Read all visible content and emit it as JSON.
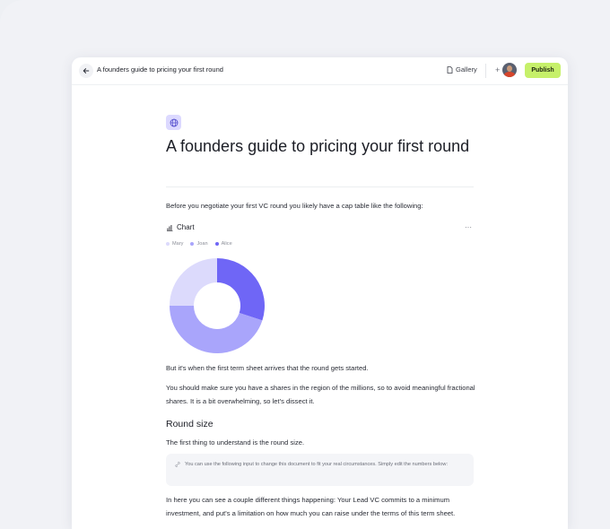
{
  "topbar": {
    "back_icon": "arrow-left-icon",
    "title": "A founders guide to pricing your first round",
    "gallery_label": "Gallery",
    "gallery_icon": "document-icon",
    "invite_symbol": "+",
    "publish_label": "Publish",
    "publish_color": "#c6f06a"
  },
  "document": {
    "icon": "globe-icon",
    "title": "A founders guide to pricing your first round",
    "intro": "Before you negotiate your first VC round you likely have a cap table like the following:",
    "chart_block": {
      "title": "Chart",
      "icon": "bar-chart-icon",
      "more_label": "···"
    },
    "para_1": "But it's when the first term sheet arrives that the round gets started.",
    "para_2": "You should make sure you have a shares in the region of the millions, so to avoid meaningful fractional shares. It is a bit overwhelming, so let's dissect it.",
    "heading_round_size": "Round size",
    "para_3": "The first thing to understand is the round size.",
    "callout": {
      "icon": "link-icon",
      "text": "You can use the following input to change this document to fit your real circumstances. Simply edit the numbers below:"
    },
    "para_4": "In here you can see a couple different things happening: Your Lead VC commits to a minimum investment, and put's a limitation on how much you can raise under the terms of this term sheet."
  },
  "chart_data": {
    "type": "pie",
    "donut": true,
    "series": [
      {
        "name": "Mary",
        "value": 25,
        "color": "#dcdafc"
      },
      {
        "name": "Joan",
        "value": 45,
        "color": "#a9a5fb"
      },
      {
        "name": "Alice",
        "value": 30,
        "color": "#6f66f6"
      }
    ],
    "legend_position": "top-left"
  }
}
